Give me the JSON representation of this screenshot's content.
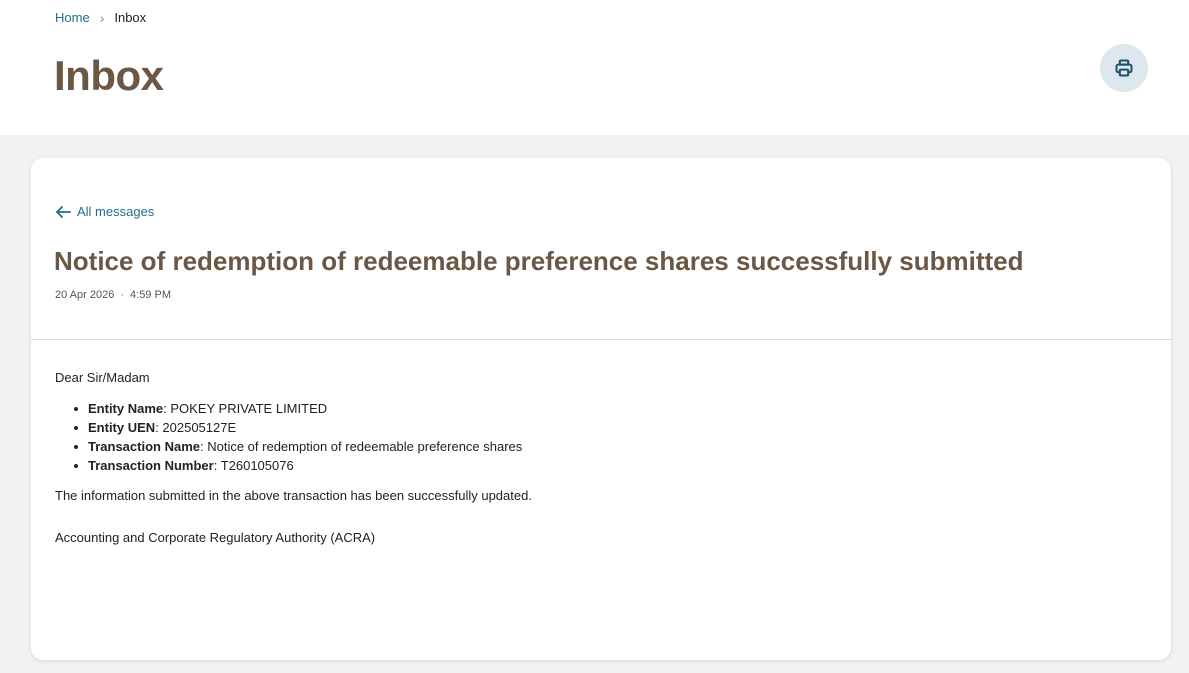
{
  "breadcrumb": {
    "home": "Home",
    "separator": "›",
    "current": "Inbox"
  },
  "page": {
    "title": "Inbox",
    "print_icon": "printer-icon"
  },
  "message": {
    "back_label": "All messages",
    "back_icon": "arrow-left-icon",
    "title": "Notice of redemption of redeemable preference shares successfully submitted",
    "date": "20 Apr 2026",
    "meta_separator": "·",
    "time": "4:59 PM",
    "greeting": "Dear Sir/Madam",
    "details": [
      {
        "label": "Entity Name",
        "value": ": POKEY PRIVATE LIMITED"
      },
      {
        "label": "Entity UEN",
        "value": ": 202505127E"
      },
      {
        "label": "Transaction Name",
        "value": ": Notice of redemption of redeemable preference shares"
      },
      {
        "label": "Transaction Number",
        "value": ": T260105076"
      }
    ],
    "body_text": "The information submitted in the above transaction has been successfully updated.",
    "signature": "Accounting and Corporate Regulatory Authority (ACRA)"
  },
  "colors": {
    "title_brown": "#6b5744",
    "link_teal": "#1f6f8b",
    "print_bg": "#dce8ee",
    "content_bg": "#f2f2f2"
  }
}
